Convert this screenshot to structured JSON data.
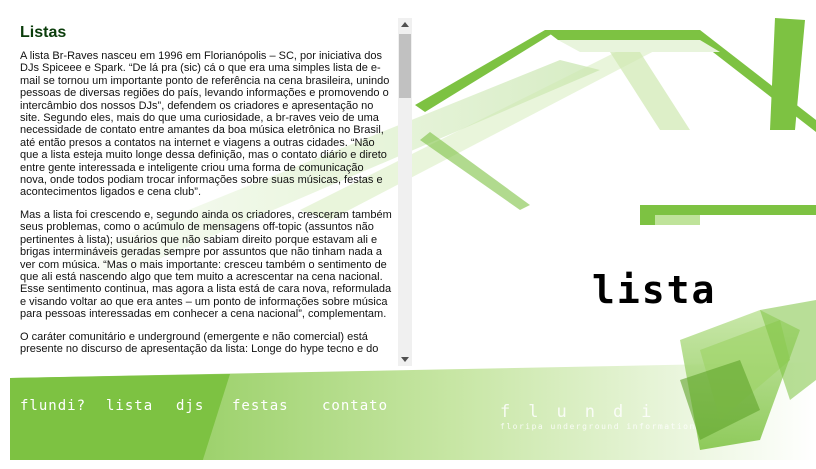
{
  "article": {
    "title": "Listas",
    "paragraphs": [
      "A lista Br-Raves nasceu em 1996 em Florianópolis – SC, por iniciativa dos DJs Spiceee e Spark. “De lá pra (sic) cá o que era uma simples lista de e-mail se tornou um importante ponto de referência na cena brasileira, unindo pessoas de diversas regiões do país, levando informações e promovendo o intercâmbio dos nossos DJs”, defendem os criadores e apresentação no site. Segundo eles, mais do que uma curiosidade, a br-raves veio de uma necessidade de contato entre amantes da boa música eletrônica no Brasil, até então presos a contatos na internet e viagens a outras cidades. “Não que a lista esteja muito longe dessa definição, mas o contato diário e direto entre gente interessada e inteligente criou uma forma de comunicação nova, onde todos podiam trocar informações sobre suas músicas, festas e acontecimentos ligados e cena club”.",
      "Mas a lista foi crescendo e, segundo ainda os criadores, cresceram também seus problemas, como o acúmulo de mensagens off-topic (assuntos não pertinentes à lista); usuários que não sabiam direito porque estavam ali e brigas intermináveis geradas sempre por assuntos que não tinham nada a ver com música. “Mas o mais importante: cresceu também o sentimento de que ali está nascendo algo que tem muito a acrescentar na cena nacional. Esse sentimento continua, mas agora a lista está de cara nova, reformulada e visando voltar ao que era antes – um ponto de informações sobre música para pessoas interessadas em conhecer a cena nacional”, complementam.",
      "O caráter comunitário e underground (emergente e não comercial) está presente no discurso de apresentação da lista: Longe do hype tecno e do"
    ]
  },
  "section_logo": "lista",
  "nav": {
    "items": [
      "flundi?",
      "lista",
      "djs",
      "festas",
      "contato"
    ]
  },
  "brand": {
    "name": "flundi",
    "tagline": "floripa underground information"
  },
  "colors": {
    "accent_green": "#7dc242",
    "dark_green": "#0b3d0b",
    "light_green": "#cfe8b0"
  }
}
